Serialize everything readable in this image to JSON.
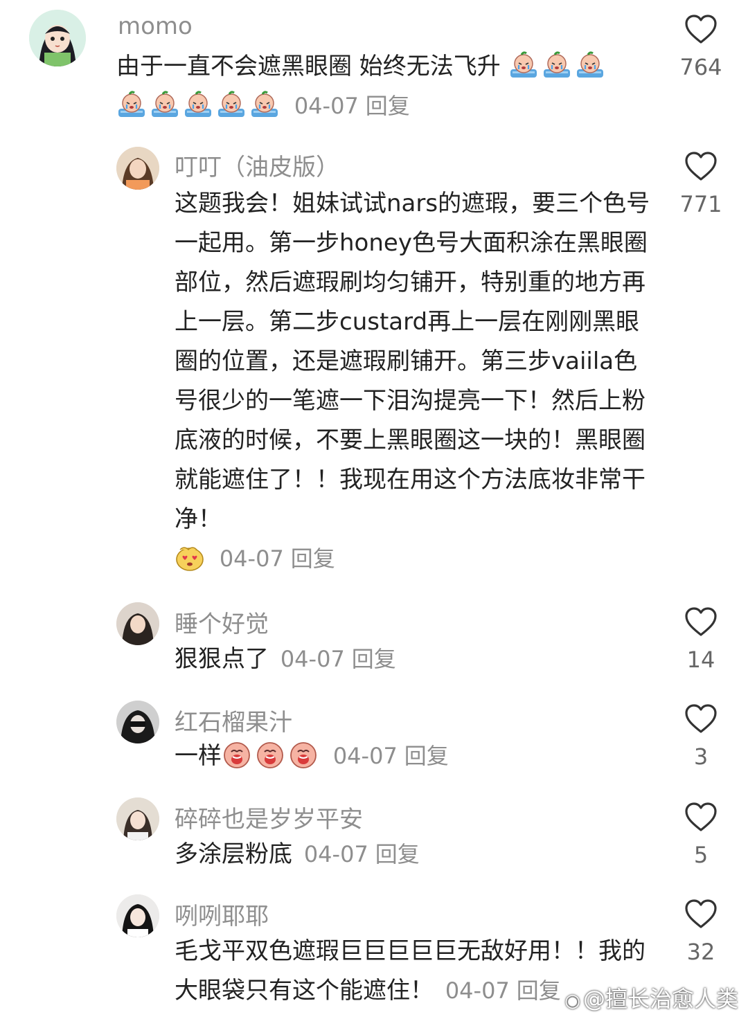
{
  "comments": [
    {
      "username": "momo",
      "text": "由于一直不会遮黑眼圈 始终无法飞升",
      "date": "04-07",
      "reply_label": "回复",
      "likes": "764",
      "emoji": "crying-bath-emoji"
    },
    {
      "username": "叮叮（油皮版）",
      "text": "这题我会！姐妹试试nars的遮瑕，要三个色号一起用。第一步honey色号大面积涂在黑眼圈部位，然后遮瑕刷均匀铺开，特别重的地方再上一层。第二步custard再上一层在刚刚黑眼圈的位置，还是遮瑕刷铺开。第三步vaiila色号很少的一笔遮一下泪沟提亮一下！然后上粉底液的时候，不要上黑眼圈这一块的！黑眼圈就能遮住了！！我现在用这个方法底妆非常干净！",
      "date": "04-07",
      "reply_label": "回复",
      "likes": "771",
      "emoji": "heart-eyes-emoji"
    },
    {
      "username": "睡个好觉",
      "text": "狠狠点了",
      "date": "04-07",
      "reply_label": "回复",
      "likes": "14"
    },
    {
      "username": "红石榴果汁",
      "text": "一样",
      "date": "04-07",
      "reply_label": "回复",
      "likes": "3",
      "emoji": "crying-peach-emoji"
    },
    {
      "username": "碎碎也是岁岁平安",
      "text": "多涂层粉底",
      "date": "04-07",
      "reply_label": "回复",
      "likes": "5"
    },
    {
      "username": "咧咧耶耶",
      "text": "毛戈平双色遮瑕巨巨巨巨巨无敌好用！！我的大眼袋只有这个能遮住！",
      "date": "04-07",
      "reply_label": "回复",
      "likes": "32"
    }
  ],
  "watermark": "@擅长治愈人类",
  "colors": {
    "meta": "#8e8e8e",
    "text": "#222222",
    "heart_outline": "#333333"
  }
}
